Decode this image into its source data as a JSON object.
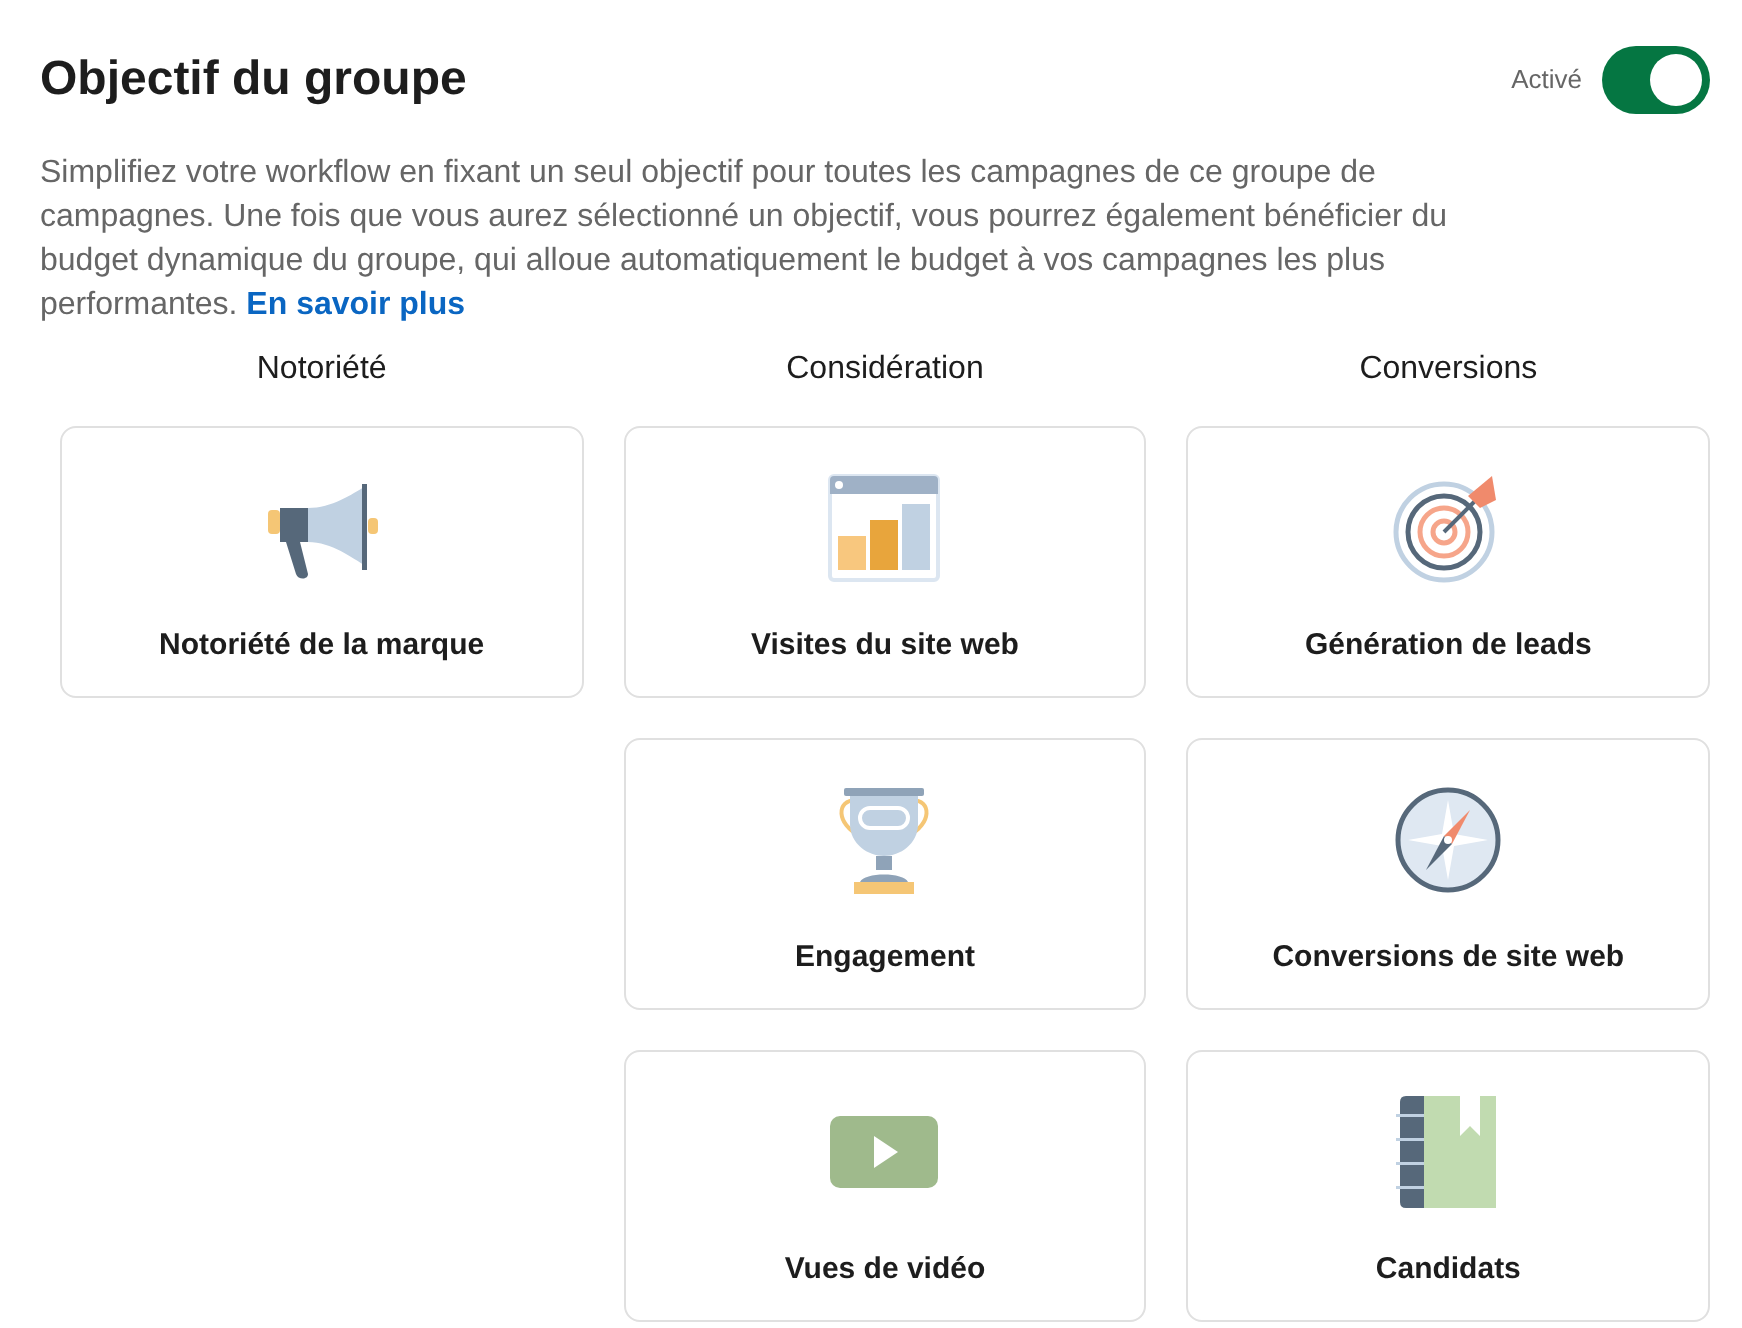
{
  "header": {
    "title": "Objectif du groupe",
    "toggle": {
      "label": "Activé",
      "on": true
    }
  },
  "description": {
    "text": "Simplifiez votre workflow en fixant un seul objectif pour toutes les campagnes de ce groupe de campagnes. Une fois que vous aurez sélectionné un objectif, vous pourrez également bénéficier du budget dynamique du groupe, qui alloue automatiquement le budget à vos campagnes les plus performantes.",
    "link": "En savoir plus"
  },
  "columns": [
    {
      "heading": "Notoriété",
      "cards": [
        {
          "kind": "megaphone",
          "label": "Notoriété de la marque"
        }
      ]
    },
    {
      "heading": "Considération",
      "cards": [
        {
          "kind": "chart",
          "label": "Visites du site web"
        },
        {
          "kind": "trophy",
          "label": "Engagement"
        },
        {
          "kind": "video",
          "label": "Vues de vidéo"
        }
      ]
    },
    {
      "heading": "Conversions",
      "cards": [
        {
          "kind": "target",
          "label": "Génération de leads"
        },
        {
          "kind": "compass",
          "label": "Conversions de site web"
        },
        {
          "kind": "notebook",
          "label": "Candidats"
        }
      ]
    }
  ]
}
